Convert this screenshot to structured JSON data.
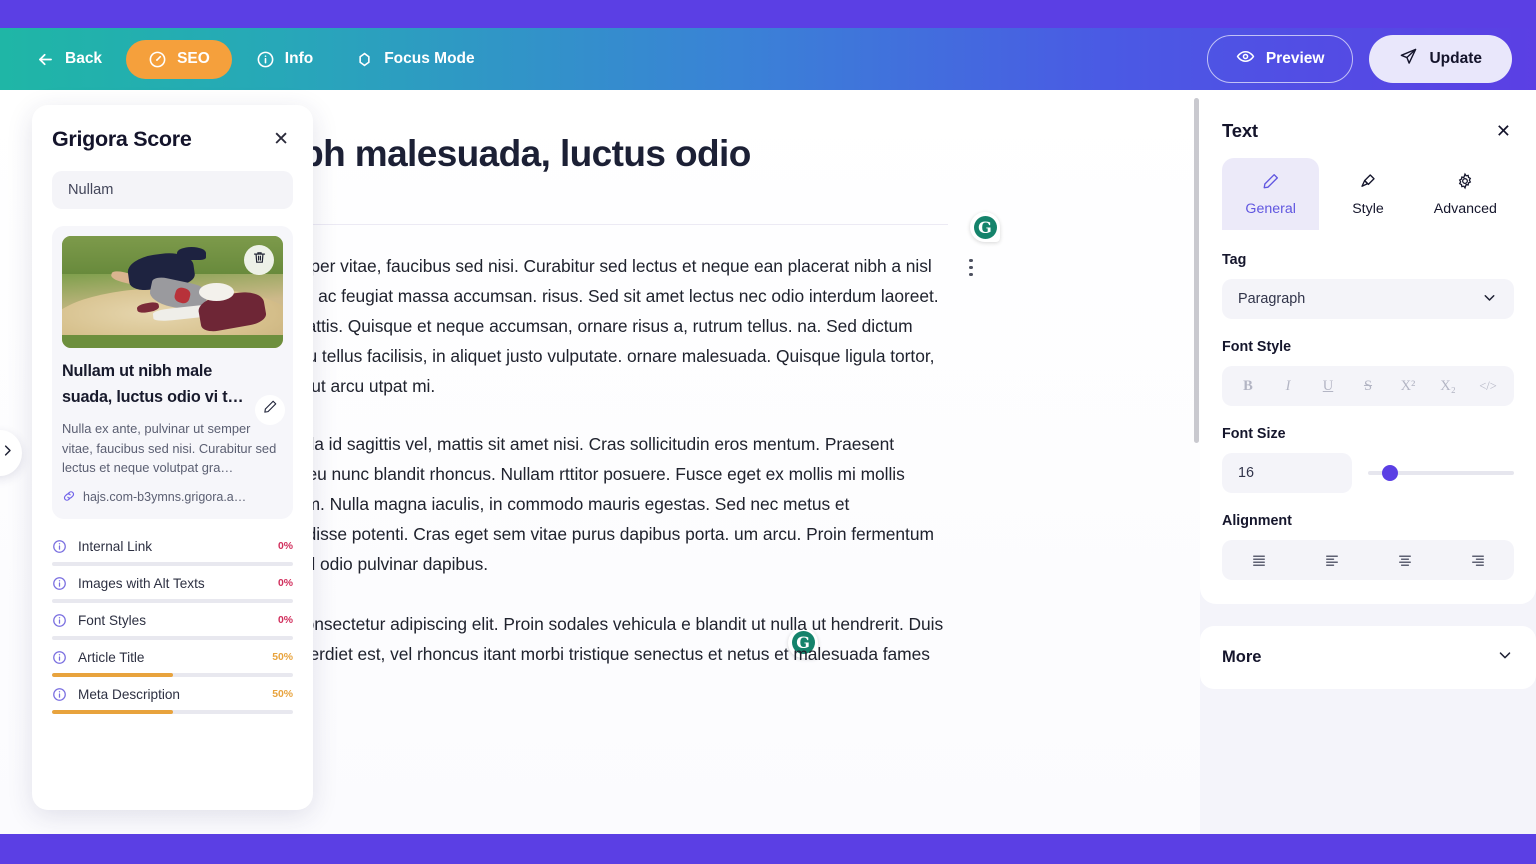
{
  "toolbar": {
    "back_label": "Back",
    "back_icon": "arrow-left-icon",
    "seo_label": "SEO",
    "seo_icon": "seo-gauge-icon",
    "info_label": "Info",
    "info_icon": "info-circle-icon",
    "focus_label": "Focus Mode",
    "focus_icon": "focus-target-icon",
    "preview_label": "Preview",
    "preview_icon": "eye-icon",
    "update_label": "Update",
    "update_icon": "send-plane-icon",
    "seo_pill_color": "#f5a03c",
    "update_bg_color": "#e9e7fb"
  },
  "score_panel": {
    "title": "Grigora Score",
    "close_icon": "close-icon",
    "search_value": "Nullam",
    "search_placeholder": "Nullam",
    "delete_icon": "trash-icon",
    "edit_icon": "pencil-icon",
    "link_icon": "link-icon",
    "card_title": "Nullam ut nibh male suada, luctus odio vi t…",
    "card_description": "Nulla ex ante, pulvinar ut semper vitae, faucibus sed nisi. Curabitur sed lectus et neque volutpat gra…",
    "card_url": "hajs.com-b3ymns.grigora.a…",
    "metrics": [
      {
        "name": "Internal Link",
        "percent": "0%",
        "value": 0,
        "color": "#d12e5c"
      },
      {
        "name": "Images with Alt Texts",
        "percent": "0%",
        "value": 0,
        "color": "#d12e5c"
      },
      {
        "name": "Font Styles",
        "percent": "0%",
        "value": 0,
        "color": "#d12e5c"
      },
      {
        "name": "Article Title",
        "percent": "50%",
        "value": 50,
        "color": "#e8a33d"
      },
      {
        "name": "Meta Description",
        "percent": "50%",
        "value": 50,
        "color": "#e8a33d"
      }
    ]
  },
  "edge_handle": {
    "icon": "chevron-right-icon"
  },
  "editor": {
    "title": "t nibh malesuada, luctus odio",
    "grammarly_icon": "grammarly-icon",
    "kebab_icon": "more-vertical-icon",
    "paragraphs": [
      "r ut semper vitae, faucibus sed nisi. Curabitur sed lectus et neque ean placerat nibh a nisl volutpat, ac feugiat massa accumsan. risus. Sed sit amet lectus nec odio interdum laoreet. Integer attis. Quisque et neque accumsan, ornare risus a, rutrum tellus. na. Sed dictum lectus eu tellus facilisis, in aliquet justo vulputate. ornare malesuada. Quisque ligula tortor, porttitor ut arcu utpat mi.",
      "n, gravida id sagittis vel, mattis sit amet nisi. Cras sollicitudin eros mentum. Praesent ultrices eu nunc blandit rhoncus. Nullam rttitor posuere. Fusce eget ex mollis mi mollis dignissim. Nulla magna iaculis, in commodo mauris egestas. Sed nec metus et Suspendisse potenti. Cras eget sem vitae purus dapibus porta. um arcu. Proin fermentum lacus vel odio pulvinar dapibus.",
      "amet, consectetur adipiscing elit. Proin sodales vehicula e blandit ut nulla ut hendrerit. Duis non imperdiet est, vel rhoncus itant morbi tristique senectus et netus et malesuada fames ac"
    ]
  },
  "right_panel": {
    "title": "Text",
    "close_icon": "close-icon",
    "tabs": [
      {
        "label": "General",
        "icon": "pencil-icon",
        "active": true
      },
      {
        "label": "Style",
        "icon": "brush-icon",
        "active": false
      },
      {
        "label": "Advanced",
        "icon": "gear-icon",
        "active": false
      }
    ],
    "tag_label": "Tag",
    "tag_value": "Paragraph",
    "tag_chevron_icon": "chevron-down-icon",
    "font_style_label": "Font Style",
    "font_style_buttons": [
      {
        "label": "B",
        "name": "bold-button"
      },
      {
        "label": "I",
        "name": "italic-button"
      },
      {
        "label": "U",
        "name": "underline-button"
      },
      {
        "label": "S",
        "name": "strikethrough-button"
      },
      {
        "label": "X²",
        "name": "superscript-button"
      },
      {
        "label": "X₂",
        "name": "subscript-button"
      },
      {
        "label": "</>",
        "name": "code-button"
      }
    ],
    "font_size_label": "Font Size",
    "font_size_value": "16",
    "alignment_label": "Alignment",
    "alignment_buttons": [
      "align-justify",
      "align-left",
      "align-center",
      "align-right"
    ],
    "more_label": "More",
    "more_chevron_icon": "chevron-down-icon",
    "accent_color": "#5b3fe4"
  }
}
